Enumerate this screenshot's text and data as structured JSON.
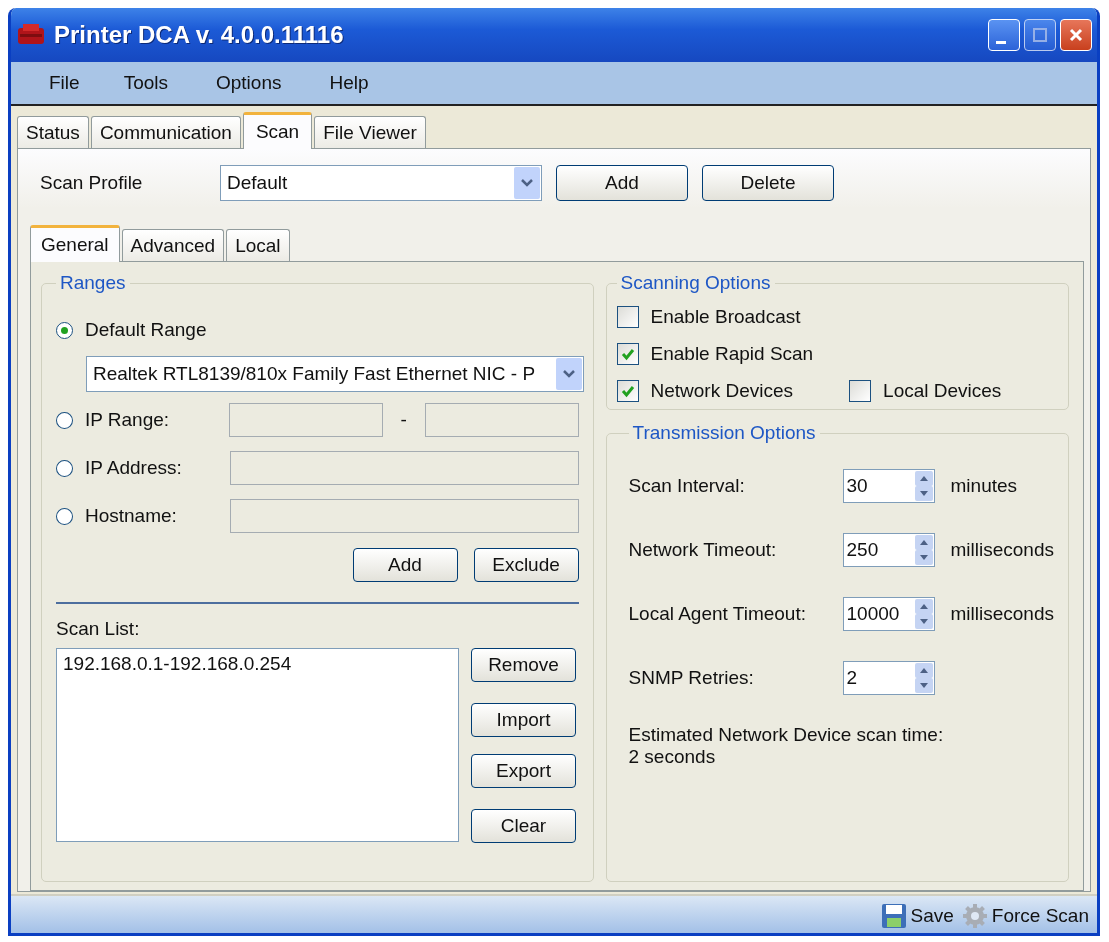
{
  "window": {
    "title": "Printer DCA v. 4.0.0.11116"
  },
  "menu": [
    "File",
    "Tools",
    "Options",
    "Help"
  ],
  "tabs": [
    {
      "label": "Status",
      "selected": false
    },
    {
      "label": "Communication",
      "selected": false
    },
    {
      "label": "Scan",
      "selected": true
    },
    {
      "label": "File Viewer",
      "selected": false
    }
  ],
  "scan_profile": {
    "label": "Scan Profile",
    "value": "Default",
    "buttons": [
      "Add",
      "Delete"
    ]
  },
  "subtabs": [
    {
      "label": "General",
      "selected": true
    },
    {
      "label": "Advanced",
      "selected": false
    },
    {
      "label": "Local",
      "selected": false
    }
  ],
  "ranges": {
    "title": "Ranges",
    "options": [
      {
        "kind": "dropdown",
        "label": "Default Range",
        "selected": true,
        "value": "Realtek RTL8139/810x Family Fast Ethernet NIC - P"
      },
      {
        "kind": "range",
        "label": "IP Range:",
        "selected": false,
        "separator": "-"
      },
      {
        "kind": "field",
        "label": "IP Address:",
        "selected": false
      },
      {
        "kind": "field",
        "label": "Hostname:",
        "selected": false
      }
    ],
    "buttons": [
      "Add",
      "Exclude"
    ]
  },
  "scan_list": {
    "label": "Scan List:",
    "items": [
      "192.168.0.1-192.168.0.254"
    ],
    "buttons": [
      "Remove",
      "Import",
      "Export",
      "Clear"
    ]
  },
  "scanning_options": {
    "title": "Scanning Options",
    "rows": [
      [
        {
          "label": "Enable Broadcast",
          "checked": false
        }
      ],
      [
        {
          "label": "Enable Rapid Scan",
          "checked": true
        }
      ],
      [
        {
          "label": "Network Devices",
          "checked": true
        },
        {
          "label": "Local Devices",
          "checked": false
        }
      ]
    ]
  },
  "transmission_options": {
    "title": "Transmission Options",
    "settings": [
      {
        "label": "Scan Interval:",
        "value": "30",
        "unit": "minutes"
      },
      {
        "label": "Network Timeout:",
        "value": "250",
        "unit": "milliseconds"
      },
      {
        "label": "Local Agent Timeout:",
        "value": "10000",
        "unit": "milliseconds"
      },
      {
        "label": "SNMP Retries:",
        "value": "2"
      }
    ],
    "estimate": [
      "Estimated Network Device scan time:",
      "2 seconds"
    ]
  },
  "status_bar": {
    "actions": [
      {
        "kind": "save",
        "label": "Save"
      },
      {
        "kind": "gear",
        "label": "Force Scan"
      }
    ]
  }
}
